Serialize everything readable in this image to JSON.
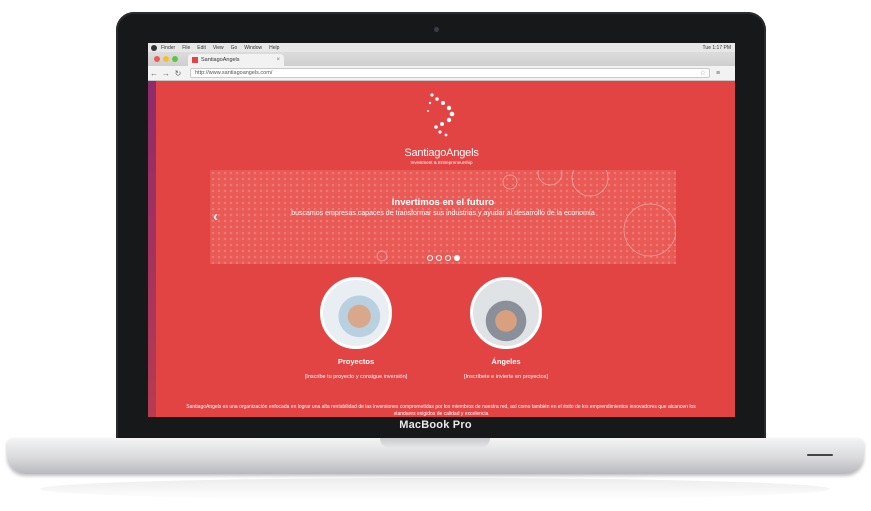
{
  "laptop": {
    "model_label": "MacBook Pro"
  },
  "os_menubar": {
    "items": [
      "Finder",
      "File",
      "Edit",
      "View",
      "Go",
      "Window",
      "Help"
    ],
    "clock": "Tue 1:17 PM"
  },
  "browser": {
    "tab_title": "SantiagoAngels",
    "url": "http://www.santiagoangels.com/",
    "tab_close": "×"
  },
  "site": {
    "brand": "SantiagoAngels",
    "tagline": "Investment & Entrepreneurship",
    "slider": {
      "title": "Invertimos en el futuro",
      "subtitle": "buscamos empresas capaces de transformar sus industrias y ayudar al desarrollo de la economía",
      "dot_count": 4,
      "active_dot": 3
    },
    "features": [
      {
        "title": "Proyectos",
        "subtitle": "[Inscribe tu proyecto y consigue inversión]"
      },
      {
        "title": "Ángeles",
        "subtitle": "[Inscríbete e invierte en proyectos]"
      }
    ],
    "about": "SantiagoAngels es una organización enfocada en lograr una alta rentabilidad de las inversiones comprometidas por los miembros de nuestra red, así como también en el éxito de los emprendimientos innovadores que alcancen los standares exigidos de calidad y excelencia"
  },
  "colors": {
    "brand_red": "#e24343",
    "slider_red": "#e95a56"
  }
}
